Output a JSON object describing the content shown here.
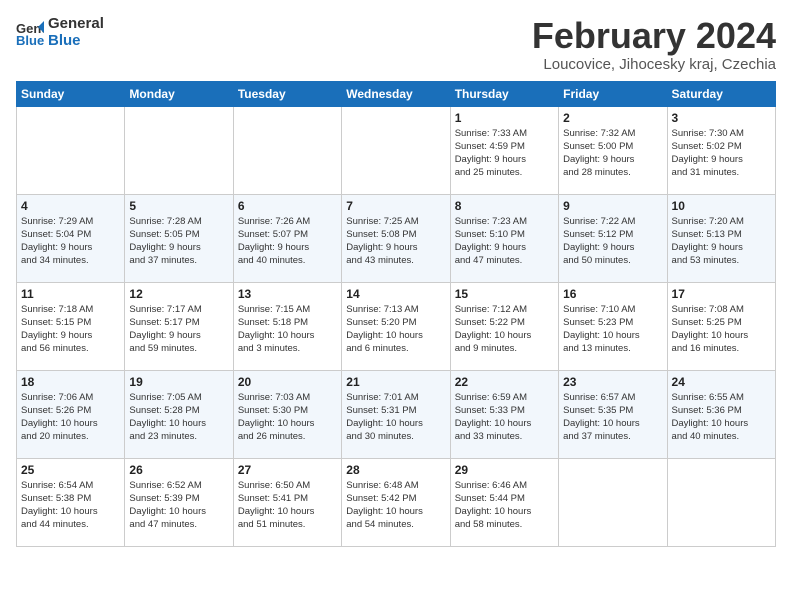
{
  "header": {
    "logo_line1": "General",
    "logo_line2": "Blue",
    "title": "February 2024",
    "subtitle": "Loucovice, Jihocesky kraj, Czechia"
  },
  "weekdays": [
    "Sunday",
    "Monday",
    "Tuesday",
    "Wednesday",
    "Thursday",
    "Friday",
    "Saturday"
  ],
  "weeks": [
    [
      {
        "day": "",
        "info": ""
      },
      {
        "day": "",
        "info": ""
      },
      {
        "day": "",
        "info": ""
      },
      {
        "day": "",
        "info": ""
      },
      {
        "day": "1",
        "info": "Sunrise: 7:33 AM\nSunset: 4:59 PM\nDaylight: 9 hours\nand 25 minutes."
      },
      {
        "day": "2",
        "info": "Sunrise: 7:32 AM\nSunset: 5:00 PM\nDaylight: 9 hours\nand 28 minutes."
      },
      {
        "day": "3",
        "info": "Sunrise: 7:30 AM\nSunset: 5:02 PM\nDaylight: 9 hours\nand 31 minutes."
      }
    ],
    [
      {
        "day": "4",
        "info": "Sunrise: 7:29 AM\nSunset: 5:04 PM\nDaylight: 9 hours\nand 34 minutes."
      },
      {
        "day": "5",
        "info": "Sunrise: 7:28 AM\nSunset: 5:05 PM\nDaylight: 9 hours\nand 37 minutes."
      },
      {
        "day": "6",
        "info": "Sunrise: 7:26 AM\nSunset: 5:07 PM\nDaylight: 9 hours\nand 40 minutes."
      },
      {
        "day": "7",
        "info": "Sunrise: 7:25 AM\nSunset: 5:08 PM\nDaylight: 9 hours\nand 43 minutes."
      },
      {
        "day": "8",
        "info": "Sunrise: 7:23 AM\nSunset: 5:10 PM\nDaylight: 9 hours\nand 47 minutes."
      },
      {
        "day": "9",
        "info": "Sunrise: 7:22 AM\nSunset: 5:12 PM\nDaylight: 9 hours\nand 50 minutes."
      },
      {
        "day": "10",
        "info": "Sunrise: 7:20 AM\nSunset: 5:13 PM\nDaylight: 9 hours\nand 53 minutes."
      }
    ],
    [
      {
        "day": "11",
        "info": "Sunrise: 7:18 AM\nSunset: 5:15 PM\nDaylight: 9 hours\nand 56 minutes."
      },
      {
        "day": "12",
        "info": "Sunrise: 7:17 AM\nSunset: 5:17 PM\nDaylight: 9 hours\nand 59 minutes."
      },
      {
        "day": "13",
        "info": "Sunrise: 7:15 AM\nSunset: 5:18 PM\nDaylight: 10 hours\nand 3 minutes."
      },
      {
        "day": "14",
        "info": "Sunrise: 7:13 AM\nSunset: 5:20 PM\nDaylight: 10 hours\nand 6 minutes."
      },
      {
        "day": "15",
        "info": "Sunrise: 7:12 AM\nSunset: 5:22 PM\nDaylight: 10 hours\nand 9 minutes."
      },
      {
        "day": "16",
        "info": "Sunrise: 7:10 AM\nSunset: 5:23 PM\nDaylight: 10 hours\nand 13 minutes."
      },
      {
        "day": "17",
        "info": "Sunrise: 7:08 AM\nSunset: 5:25 PM\nDaylight: 10 hours\nand 16 minutes."
      }
    ],
    [
      {
        "day": "18",
        "info": "Sunrise: 7:06 AM\nSunset: 5:26 PM\nDaylight: 10 hours\nand 20 minutes."
      },
      {
        "day": "19",
        "info": "Sunrise: 7:05 AM\nSunset: 5:28 PM\nDaylight: 10 hours\nand 23 minutes."
      },
      {
        "day": "20",
        "info": "Sunrise: 7:03 AM\nSunset: 5:30 PM\nDaylight: 10 hours\nand 26 minutes."
      },
      {
        "day": "21",
        "info": "Sunrise: 7:01 AM\nSunset: 5:31 PM\nDaylight: 10 hours\nand 30 minutes."
      },
      {
        "day": "22",
        "info": "Sunrise: 6:59 AM\nSunset: 5:33 PM\nDaylight: 10 hours\nand 33 minutes."
      },
      {
        "day": "23",
        "info": "Sunrise: 6:57 AM\nSunset: 5:35 PM\nDaylight: 10 hours\nand 37 minutes."
      },
      {
        "day": "24",
        "info": "Sunrise: 6:55 AM\nSunset: 5:36 PM\nDaylight: 10 hours\nand 40 minutes."
      }
    ],
    [
      {
        "day": "25",
        "info": "Sunrise: 6:54 AM\nSunset: 5:38 PM\nDaylight: 10 hours\nand 44 minutes."
      },
      {
        "day": "26",
        "info": "Sunrise: 6:52 AM\nSunset: 5:39 PM\nDaylight: 10 hours\nand 47 minutes."
      },
      {
        "day": "27",
        "info": "Sunrise: 6:50 AM\nSunset: 5:41 PM\nDaylight: 10 hours\nand 51 minutes."
      },
      {
        "day": "28",
        "info": "Sunrise: 6:48 AM\nSunset: 5:42 PM\nDaylight: 10 hours\nand 54 minutes."
      },
      {
        "day": "29",
        "info": "Sunrise: 6:46 AM\nSunset: 5:44 PM\nDaylight: 10 hours\nand 58 minutes."
      },
      {
        "day": "",
        "info": ""
      },
      {
        "day": "",
        "info": ""
      }
    ]
  ]
}
